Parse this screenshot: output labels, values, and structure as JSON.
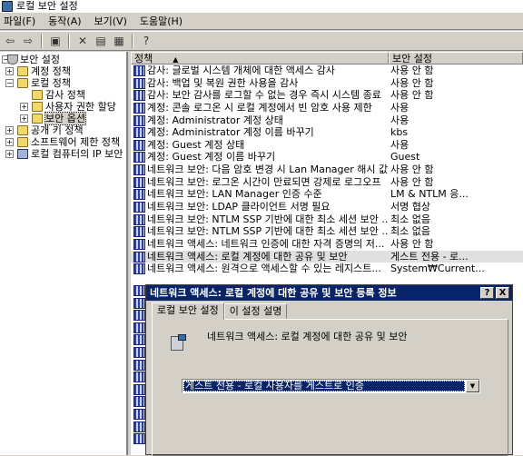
{
  "window": {
    "title": "로컬 보안 설정"
  },
  "menu": [
    "파일(F)",
    "동작(A)",
    "보기(V)",
    "도움말(H)"
  ],
  "tree": [
    {
      "label": "보안 설정",
      "level": 0,
      "exp": "-",
      "icon": "shield"
    },
    {
      "label": "계정 정책",
      "level": 1,
      "exp": "+",
      "icon": "folder"
    },
    {
      "label": "로컬 정책",
      "level": 1,
      "exp": "-",
      "icon": "folder"
    },
    {
      "label": "감사 정책",
      "level": 2,
      "exp": "",
      "icon": "folder"
    },
    {
      "label": "사용자 권한 할당",
      "level": 2,
      "exp": "+",
      "icon": "folder"
    },
    {
      "label": "보안 옵션",
      "level": 2,
      "exp": "+",
      "icon": "folder",
      "selected": true
    },
    {
      "label": "공개 키 정책",
      "level": 1,
      "exp": "+",
      "icon": "folder"
    },
    {
      "label": "소프트웨어 제한 정책",
      "level": 1,
      "exp": "+",
      "icon": "folder"
    },
    {
      "label": "로컬 컴퓨터의 IP 보안",
      "level": 1,
      "exp": "+",
      "icon": "computer"
    }
  ],
  "list": {
    "headers": {
      "policy": "정책",
      "setting": "보안 설정"
    },
    "rows": [
      {
        "policy": "감사: 글로벌 시스템 개체에 대한 액세스 감사",
        "setting": "사용 안 함"
      },
      {
        "policy": "감사: 백업 및 복원 권한 사용을 감사",
        "setting": "사용 안 함"
      },
      {
        "policy": "감사: 보안 감사를 로그할 수 없는 경우 즉시 시스템 종료",
        "setting": "사용 안 함"
      },
      {
        "policy": "계정: 콘솔 로그온 시 로컬 계정에서 빈 암호 사용 제한",
        "setting": "사용"
      },
      {
        "policy": "계정: Administrator 계정 상태",
        "setting": "사용"
      },
      {
        "policy": "계정: Administrator 계정 이름 바꾸기",
        "setting": "kbs"
      },
      {
        "policy": "계정: Guest 계정 상태",
        "setting": "사용"
      },
      {
        "policy": "계정: Guest 계정 이름 바꾸기",
        "setting": "Guest"
      },
      {
        "policy": "네트워크 보안: 다음 암호 변경 시 Lan Manager 해시 값...",
        "setting": "사용 안 함"
      },
      {
        "policy": "네트워크 보안: 로그온 시간이 만료되면 강제로 로그오프",
        "setting": "사용 안 함"
      },
      {
        "policy": "네트워크 보안: LAN Manager 인증 수준",
        "setting": "LM & NTLM 응..."
      },
      {
        "policy": "네트워크 보안: LDAP 클라이언트 서명 필요",
        "setting": "서명 협상"
      },
      {
        "policy": "네트워크 보안: NTLM SSP 기반에 대한 최소 세션 보안 ...",
        "setting": "최소 없음"
      },
      {
        "policy": "네트워크 보안: NTLM SSP 기반에 대한 최소 세션 보안 ...",
        "setting": "최소 없음"
      },
      {
        "policy": "네트워크 액세스: 네트워크 인증에 대한 자격 증명의 저...",
        "setting": "사용 안 함"
      },
      {
        "policy": "네트워크 액세스: 로컬 계정에 대한 공유 및 보안",
        "setting": "게스트 전용 - 로...",
        "selected": true
      },
      {
        "policy": "네트워크 액세스: 원격으로 액세스할 수 있는 레지스트...",
        "setting": "System₩Current..."
      }
    ]
  },
  "dialog": {
    "title": "네트워크 액세스: 로컬 계정에 대한 공유 및 보안 등록 정보",
    "help_label": "?",
    "close_label": "X",
    "tabs": [
      "로컬 보안 설정",
      "이 설정 설명"
    ],
    "policy_name": "네트워크 액세스: 로컬 계정에 대한 공유 및 보안",
    "combo_value": "게스트 전용 - 로컬 사용자를 게스트로 인증"
  }
}
